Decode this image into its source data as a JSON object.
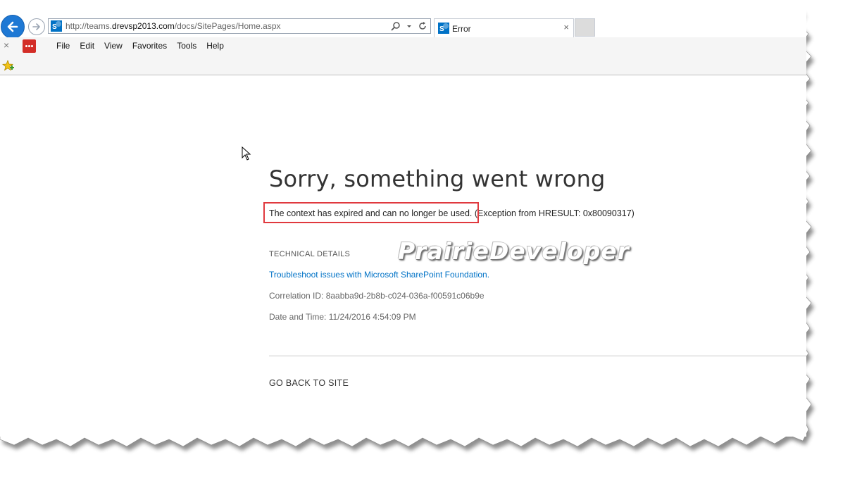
{
  "browser": {
    "url_prefix": "http://teams.",
    "url_domain": "drevsp2013.com",
    "url_path": "/docs/SitePages/Home.aspx",
    "tab_title": "Error",
    "tab_close_glyph": "×",
    "close_glyph": "×",
    "menu": [
      "File",
      "Edit",
      "View",
      "Favorites",
      "Tools",
      "Help"
    ],
    "icons": {
      "back": "back-arrow-icon",
      "forward": "forward-arrow-icon",
      "search": "search-icon",
      "refresh": "refresh-icon",
      "favorites": "favorites-star-icon",
      "lastpass": "lastpass-icon",
      "sharepoint": "sharepoint-icon"
    }
  },
  "page": {
    "title": "Sorry, something went wrong",
    "message_highlighted": "The context has expired and can no longer be used.",
    "message_rest": " (Exception from HRESULT: 0x80090317)",
    "tech_details_heading": "TECHNICAL DETAILS",
    "troubleshoot_link": "Troubleshoot issues with Microsoft SharePoint Foundation.",
    "correlation_id": "Correlation ID: 8aabba9d-2b8b-c024-036a-f00591c06b9e",
    "date_time": "Date and Time: 11/24/2016 4:54:09 PM",
    "go_back": "GO BACK TO SITE",
    "watermark": "PrairieDeveloper"
  },
  "colors": {
    "accent_blue": "#1e78d4",
    "link_blue": "#0072c6",
    "highlight_red": "#e0393e",
    "sharepoint_blue": "#0072c6"
  }
}
